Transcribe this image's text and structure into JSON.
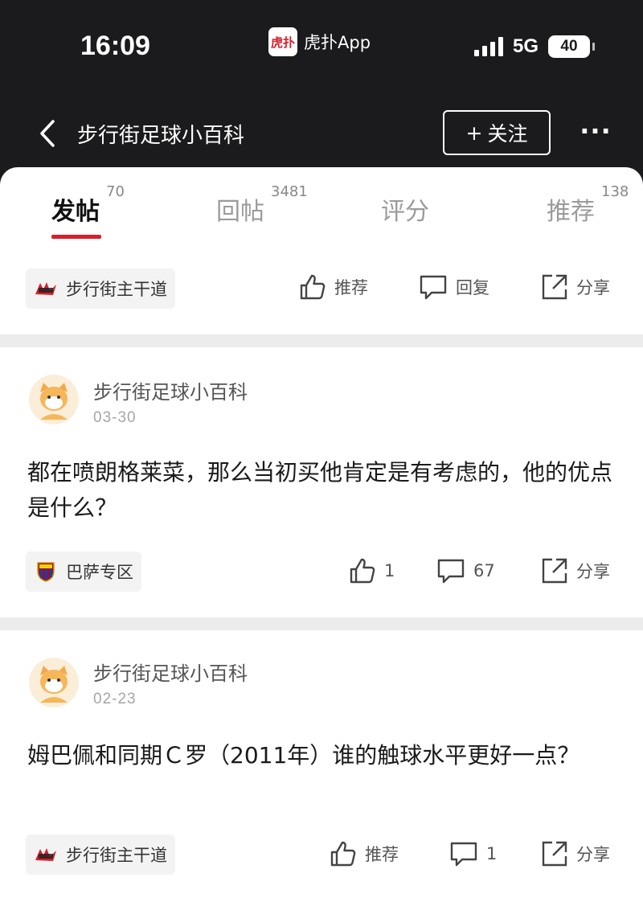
{
  "status_bar": {
    "time": "16:09",
    "app_name": "虎扑App",
    "network": "5G",
    "battery": "40"
  },
  "header": {
    "title": "步行街足球小百科",
    "follow_label": "关注",
    "follow_plus": "+",
    "more": "···"
  },
  "tabs": [
    {
      "label": "发帖",
      "count": "70",
      "active": true
    },
    {
      "label": "回帖",
      "count": "3481",
      "active": false
    },
    {
      "label": "评分",
      "count": "",
      "active": false
    },
    {
      "label": "推荐",
      "count": "138",
      "active": false
    }
  ],
  "posts": [
    {
      "tag": "步行街主干道",
      "tag_icon": "hupu-logo-icon",
      "like_label": "推荐",
      "reply_label": "回复",
      "share_label": "分享"
    },
    {
      "author": "步行街足球小百科",
      "date": "03-30",
      "text": "都在喷朗格莱菜，那么当初买他肯定是有考虑的，他的优点是什么？",
      "tag": "巴萨专区",
      "tag_icon": "barcelona-crest-icon",
      "like_label": "1",
      "reply_label": "67",
      "share_label": "分享"
    },
    {
      "author": "步行街足球小百科",
      "date": "02-23",
      "text": "姆巴佩和同期Ｃ罗（2011年）谁的触球水平更好一点？",
      "tag": "步行街主干道",
      "tag_icon": "hupu-logo-icon",
      "like_label": "推荐",
      "reply_label": "1",
      "share_label": "分享"
    }
  ],
  "colors": {
    "header_bg": "#1b1b1d",
    "accent": "#d6202a",
    "page_bg": "#ececec"
  }
}
